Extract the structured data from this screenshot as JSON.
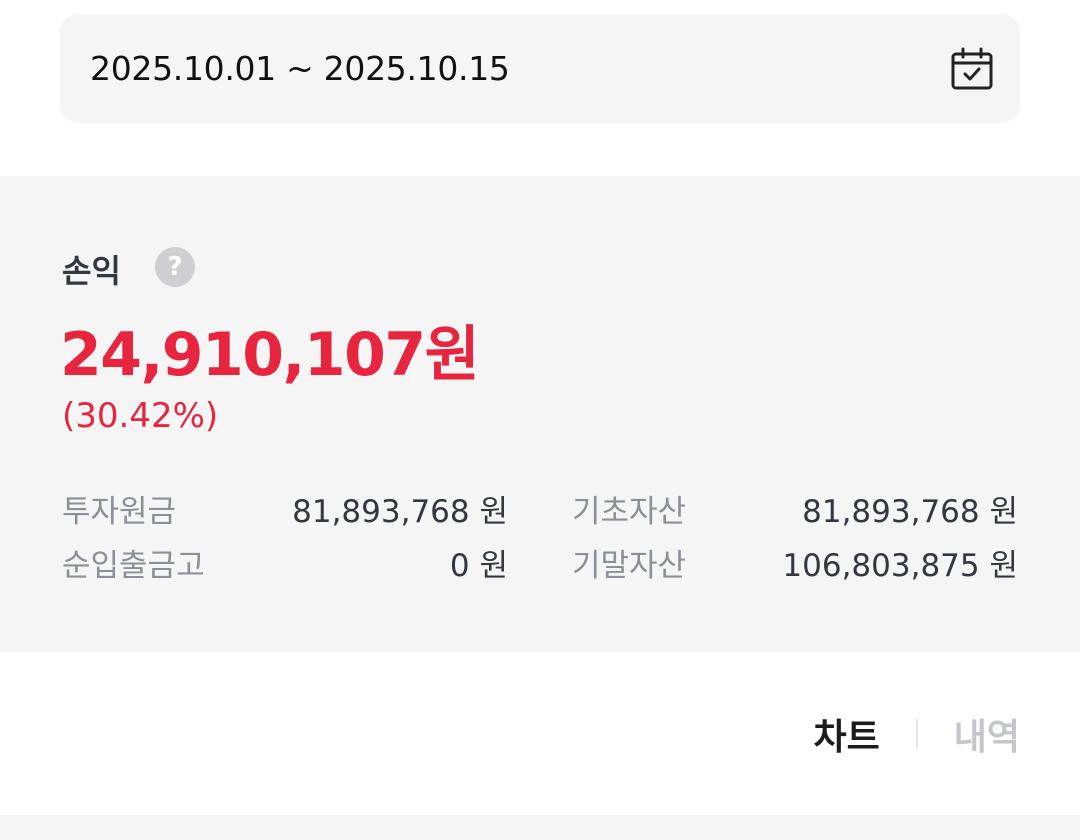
{
  "date_range": {
    "text": "2025.10.01 ~ 2025.10.15",
    "icon": "calendar-check-icon"
  },
  "profit_loss": {
    "label": "손익",
    "help_glyph": "?",
    "value": "24,910,107원",
    "percent": "(30.42%)",
    "color": "#e8253e"
  },
  "stats": {
    "principal": {
      "label": "투자원금",
      "value": "81,893,768 원"
    },
    "net_deposit": {
      "label": "순입출금고",
      "value": "0 원"
    },
    "opening_assets": {
      "label": "기초자산",
      "value": "81,893,768 원"
    },
    "closing_assets": {
      "label": "기말자산",
      "value": "106,803,875 원"
    }
  },
  "tabs": {
    "chart": "차트",
    "history": "내역",
    "active": "chart"
  }
}
